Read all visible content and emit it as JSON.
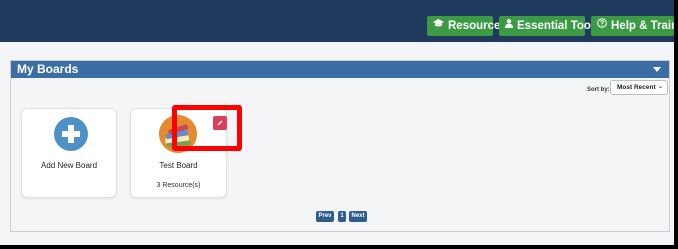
{
  "topbar": {
    "buttons": [
      {
        "label": "Resources",
        "icon": "graduation-cap-icon"
      },
      {
        "label": "Essential Toolkit",
        "icon": "person-icon"
      },
      {
        "label": "Help & Training",
        "icon": "question-circle-icon"
      }
    ]
  },
  "panel": {
    "title": "My Boards",
    "sort": {
      "label": "Sort by:",
      "selected": "Most Recent"
    }
  },
  "cards": [
    {
      "label": "Add New Board",
      "icon": "plus-circle-icon"
    },
    {
      "label": "Test Board",
      "count": "3 Resource(s)",
      "icon": "books-icon"
    }
  ],
  "pagination": {
    "prev": "Prev",
    "page": "1",
    "next": "Next"
  },
  "colors": {
    "topbar": "#1f3a5c",
    "button_green": "#3a9b44",
    "panel_header": "#3a6ea5",
    "highlight": "#ff0000",
    "edit_button": "#d9415a"
  }
}
